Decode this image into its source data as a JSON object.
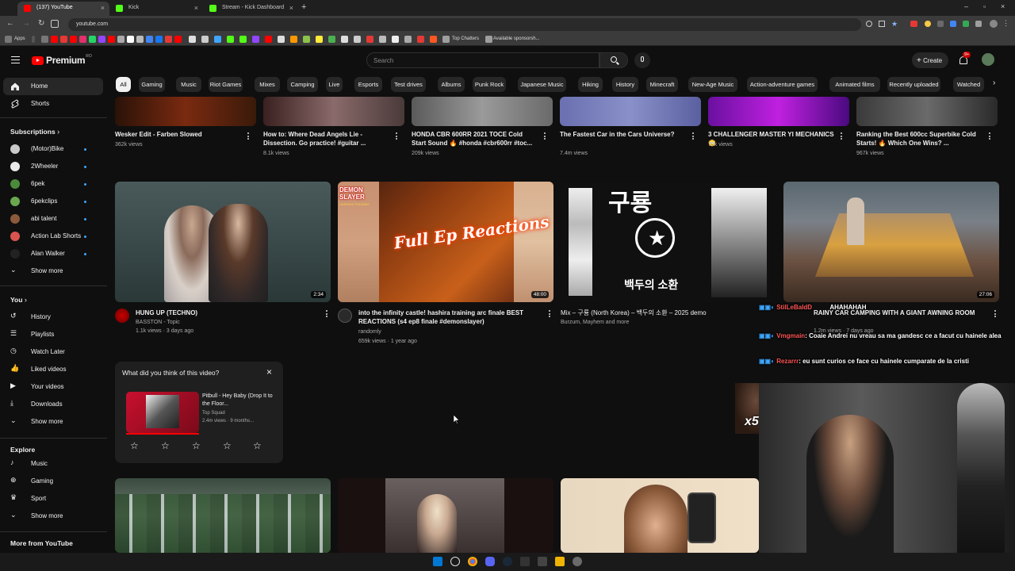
{
  "browser": {
    "tabs": [
      {
        "title": "(137) YouTube",
        "color": "#ff0000",
        "active": true
      },
      {
        "title": "Kick",
        "color": "#53fc18",
        "active": false
      },
      {
        "title": "Stream - Kick Dashboard",
        "color": "#53fc18",
        "active": false
      }
    ],
    "url": "youtube.com",
    "bookmarks": {
      "apps": "Apps",
      "top_chatters": "Top Chatters",
      "available": "Available sponsorsh..."
    }
  },
  "header": {
    "logo": "Premium",
    "logo_sup": "RO",
    "search_placeholder": "Search",
    "create": "Create",
    "notif_count": "9+"
  },
  "chips": [
    "All",
    "Gaming",
    "Music",
    "Riot Games",
    "Mixes",
    "Camping",
    "Live",
    "Esports",
    "Test drives",
    "Albums",
    "Punk Rock",
    "Japanese Music",
    "Hiking",
    "History",
    "Minecraft",
    "New-Age Music",
    "Action-adventure games",
    "Animated films",
    "Recently uploaded",
    "Watched"
  ],
  "sidebar": {
    "home": "Home",
    "shorts": "Shorts",
    "subscriptions": "Subscriptions",
    "subs": [
      {
        "name": "(Motor)Bike",
        "color": "#c9c9c9"
      },
      {
        "name": "2Wheeler",
        "color": "#e8e8e8"
      },
      {
        "name": "6pek",
        "color": "#4a8a3a"
      },
      {
        "name": "6pekclips",
        "color": "#6aa84f"
      },
      {
        "name": "abi talent",
        "color": "#8a5a3a"
      },
      {
        "name": "Action Lab Shorts",
        "color": "#d9534f"
      },
      {
        "name": "Alan Walker",
        "color": "#222222"
      }
    ],
    "show_more": "Show more",
    "you": "You",
    "you_items": [
      "History",
      "Playlists",
      "Watch Later",
      "Liked videos",
      "Your videos",
      "Downloads",
      "Show more"
    ],
    "explore": "Explore",
    "explore_items": [
      "Music",
      "Gaming",
      "Sport",
      "Show more"
    ],
    "more_from": "More from YouTube"
  },
  "row1": [
    {
      "title": "Wesker Edit - Farben Slowed",
      "meta": "362k views"
    },
    {
      "title": "How to: Where Dead Angels Lie - Dissection. Go practice! #guitar ...",
      "meta": "8.1k views"
    },
    {
      "title": "HONDA CBR 600RR 2021 TOCE Cold Start Sound 🔥 #honda #cbr600rr #toc...",
      "meta": "209k views"
    },
    {
      "title": "The Fastest Car in the Cars Universe?",
      "meta": "7.4m views"
    },
    {
      "title": "3 CHALLENGER MASTER YI MECHANICS 😳",
      "meta": "70k views"
    },
    {
      "title": "Ranking the Best 600cc Superbike Cold Starts! 🔥 Which One Wins? ...",
      "meta": "967k views"
    }
  ],
  "row2": [
    {
      "title": "HUNG UP (TECHNO)",
      "channel": "BASSTON - Topic",
      "meta": "1.1k views · 3 days ago",
      "duration": "2:34"
    },
    {
      "title": "into the infinity castle! hashira training arc finale BEST REACTIONS (s4 ep8 finale #demonslayer)",
      "channel": "randomly",
      "meta": "659k views · 1 year ago",
      "duration": "48:00"
    },
    {
      "title": "Mix – 구룡 (North Korea) – 백두의 소환 – 2025 demo",
      "channel": "Burzum, Mayhem and more",
      "meta": ""
    },
    {
      "title": "RAINY CAR CAMPING WITH A GIANT AWNING ROOM",
      "channel": "",
      "meta": "1.2m views · 7 days ago",
      "duration": "27:06"
    }
  ],
  "thumb_text": {
    "demon": "DEMON SLAYER",
    "demon_sub": "HASHIRA TRAINING",
    "reactions": "Full Ep Reactions",
    "kr_big": "구룡",
    "kr_bottom": "백두의 소환"
  },
  "survey": {
    "question": "What did you think of this video?",
    "title": "Pitbull - Hey Baby (Drop It to the Floor...",
    "channel": "Top Squad",
    "meta": "2.4m views · 9 months..."
  },
  "chat": [
    {
      "user": "StilLeBaldD",
      "msg": "AHAHAHAH",
      "color": "#ff5555"
    },
    {
      "user": "Vmgmain",
      "msg": "Coaie Andrei nu vreau sa ma gandesc ce a facut cu hainele alea",
      "color": "#ff5555"
    },
    {
      "user": "Rezarrr",
      "msg": "eu sunt curios ce face cu hainele cumparate de la cristi",
      "color": "#ff5555"
    }
  ],
  "x5": "x5"
}
